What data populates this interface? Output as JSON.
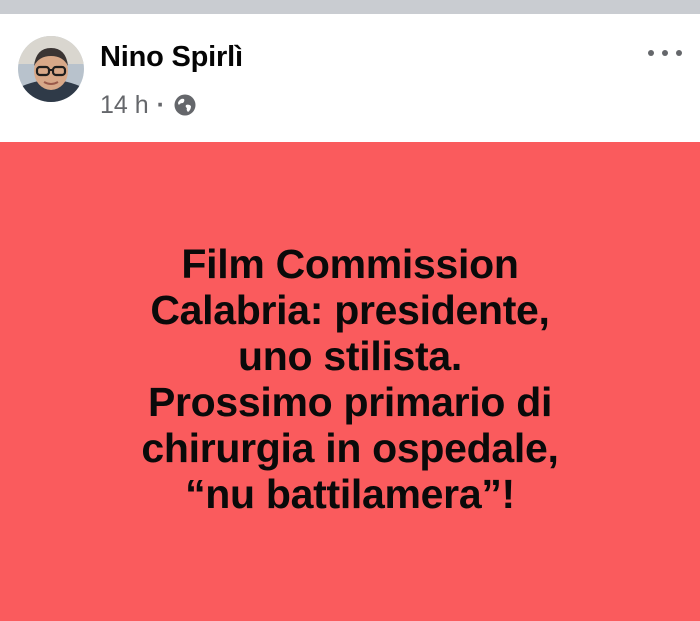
{
  "post": {
    "author": "Nino Spirlì",
    "time": "14 h",
    "separator": "·",
    "audience_icon": "globe-icon",
    "more_icon": "more-options-icon",
    "background_color": "#fa5b5d",
    "text_lines": [
      "Film Commission",
      "Calabria: presidente,",
      "uno stilista.",
      "Prossimo primario di",
      "chirurgia in ospedale,",
      "“nu battilamera”!"
    ]
  }
}
